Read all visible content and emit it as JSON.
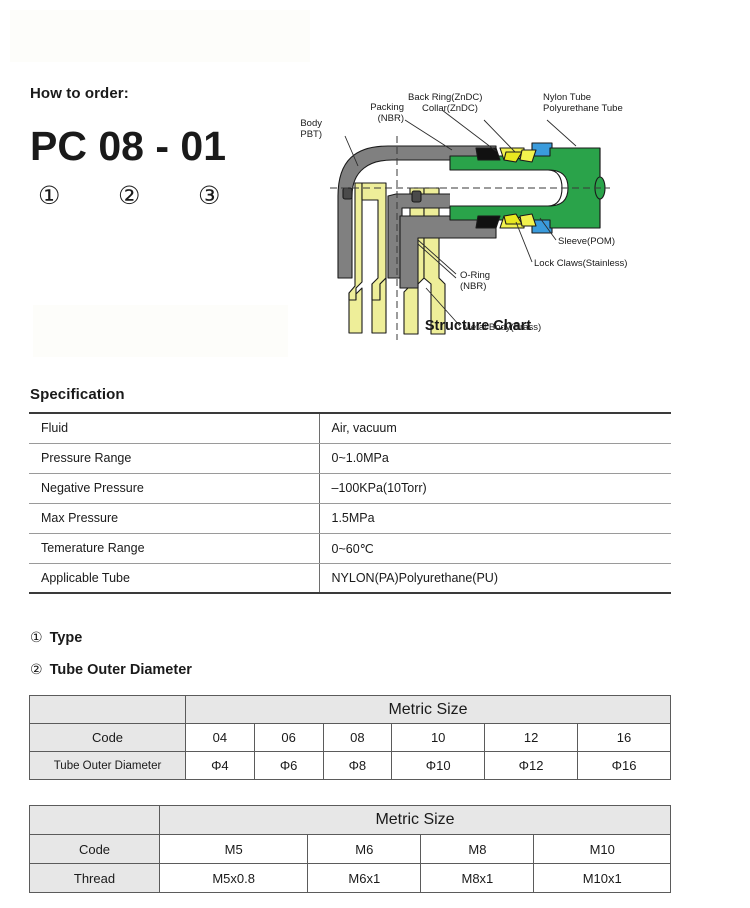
{
  "order": {
    "heading": "How to order:",
    "part_number": "PC 08 - 01",
    "markers": [
      "①",
      "②",
      "③"
    ]
  },
  "structure_chart": {
    "caption": "Structure Chart",
    "labels": {
      "resin_body": "Resin Body",
      "resin_body_sub": "(PBT)",
      "packing": "Packing",
      "packing_sub": "(NBR)",
      "back_ring": "Back Ring(ZnDC)",
      "collar": "Collar(ZnDC)",
      "nylon_tube": "Nylon Tube",
      "polyurethane_tube": "Polyurethane Tube",
      "sleeve": "Sleeve(POM)",
      "lock_claws": "Lock Claws(Stainless)",
      "o_ring": "O-Ring",
      "o_ring_sub": "(NBR)",
      "metal_body": "Metal Body(Brass)"
    },
    "colors": {
      "tube_green": "#2aa34a",
      "sleeve_blue": "#3a9bdc",
      "resin_gray": "#808080",
      "brass_yellow": "#eeee99",
      "packing_black": "#111111",
      "outline": "#1a1a1a"
    }
  },
  "specification": {
    "heading": "Specification",
    "rows": [
      {
        "key": "Fluid",
        "value": "Air, vacuum"
      },
      {
        "key": "Pressure Range",
        "value": "0~1.0MPa"
      },
      {
        "key": "Negative Pressure",
        "value": "–100KPa(10Torr)"
      },
      {
        "key": "Max Pressure",
        "value": "1.5MPa"
      },
      {
        "key": "Temerature Range",
        "value": "0~60℃"
      },
      {
        "key": "Applicable Tube",
        "value": "NYLON(PA)Polyurethane(PU)"
      }
    ]
  },
  "sections": {
    "type": {
      "mark": "①",
      "label": "Type"
    },
    "tube_outer_diameter": {
      "mark": "②",
      "label": "Tube Outer Diameter"
    }
  },
  "tube_table": {
    "group_header": "Metric Size",
    "row_labels": [
      "Code",
      "Tube Outer Diameter"
    ],
    "codes": [
      "04",
      "06",
      "08",
      "10",
      "12",
      "16"
    ],
    "diameters": [
      "Φ4",
      "Φ6",
      "Φ8",
      "Φ10",
      "Φ12",
      "Φ16"
    ]
  },
  "thread_table": {
    "group_header": "Metric Size",
    "row_labels": [
      "Code",
      "Thread"
    ],
    "codes": [
      "M5",
      "M6",
      "M8",
      "M10"
    ],
    "threads": [
      "M5x0.8",
      "M6x1",
      "M8x1",
      "M10x1"
    ]
  }
}
